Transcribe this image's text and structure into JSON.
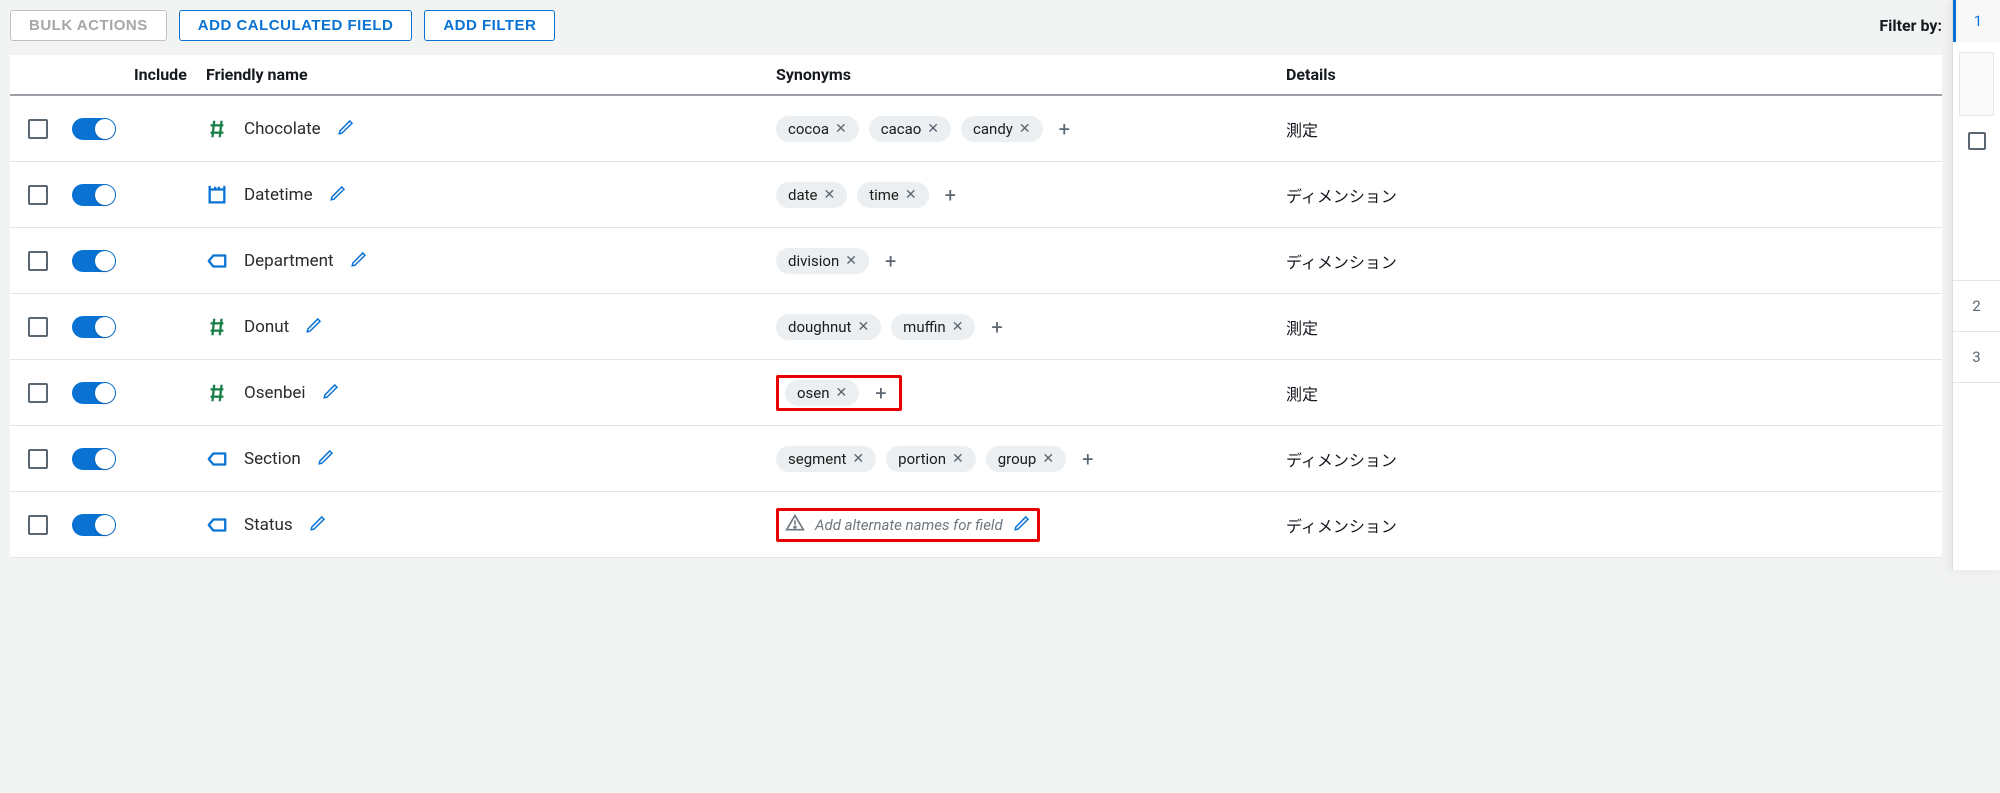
{
  "toolbar": {
    "bulk_actions": "BULK ACTIONS",
    "add_calculated_field": "ADD CALCULATED FIELD",
    "add_filter": "ADD FILTER",
    "filter_by": "Filter by:"
  },
  "columns": {
    "include": "Include",
    "friendly_name": "Friendly name",
    "synonyms": "Synonyms",
    "details": "Details"
  },
  "rows": [
    {
      "name": "Chocolate",
      "icon": "hash-green",
      "synonyms": [
        "cocoa",
        "cacao",
        "candy"
      ],
      "details": "測定",
      "highlight": false
    },
    {
      "name": "Datetime",
      "icon": "calendar",
      "synonyms": [
        "date",
        "time"
      ],
      "details": "ディメンション",
      "highlight": false
    },
    {
      "name": "Department",
      "icon": "tag",
      "synonyms": [
        "division"
      ],
      "details": "ディメンション",
      "highlight": false
    },
    {
      "name": "Donut",
      "icon": "hash-green",
      "synonyms": [
        "doughnut",
        "muffin"
      ],
      "details": "測定",
      "highlight": false
    },
    {
      "name": "Osenbei",
      "icon": "hash-green",
      "synonyms": [
        "osen"
      ],
      "details": "測定",
      "highlight": true
    },
    {
      "name": "Section",
      "icon": "tag",
      "synonyms": [
        "segment",
        "portion",
        "group"
      ],
      "details": "ディメンション",
      "highlight": false
    },
    {
      "name": "Status",
      "icon": "tag",
      "synonyms": [],
      "details": "ディメンション",
      "highlight": true,
      "empty_msg": "Add alternate names for field"
    }
  ],
  "sidepanel": {
    "items": [
      "1",
      "2",
      "3"
    ]
  }
}
